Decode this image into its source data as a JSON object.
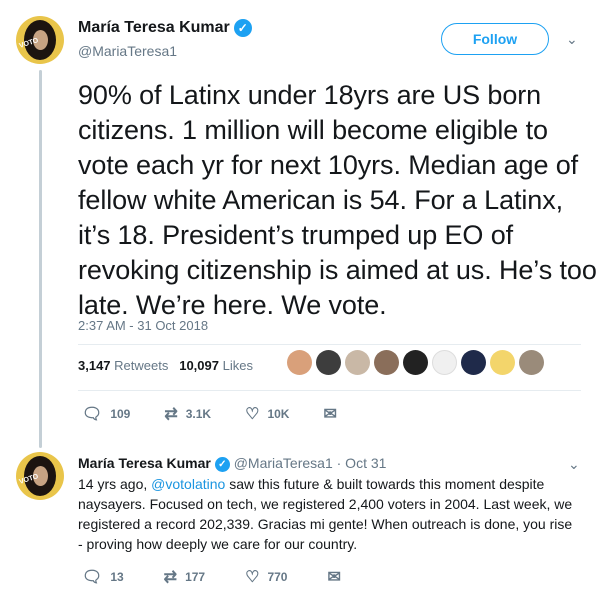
{
  "main_tweet": {
    "author_name": "María Teresa Kumar",
    "handle": "@MariaTeresa1",
    "follow_label": "Follow",
    "text": "90% of Latinx under 18yrs are US born citizens. 1 million will become eligible to vote each yr for next 10yrs. Median age of fellow white American is 54. For a Latinx, it’s 18. President’s trumped up EO of revoking citizenship is aimed at us. He’s too late. We’re here. We vote.",
    "timestamp": "2:37 AM - 31 Oct 2018",
    "retweets_count": "3,147",
    "retweets_label": "Retweets",
    "likes_count": "10,097",
    "likes_label": "Likes",
    "replies": "109",
    "retweets_short": "3.1K",
    "likes_short": "10K"
  },
  "reply_tweet": {
    "author_name": "María Teresa Kumar",
    "handle": "@MariaTeresa1",
    "date": "· Oct 31",
    "text_prefix": "14 yrs ago, ",
    "mention": "@votolatino",
    "text_rest": " saw this future & built towards this moment despite naysayers. Focused on tech, we registered 2,400 voters in 2004. Last week, we registered a record 202,339. Gracias mi gente! When outreach is done, you rise - proving how deeply we care for our country.",
    "replies": "13",
    "retweets": "177",
    "likes": "770"
  },
  "icons": {
    "verified": "verified-check",
    "reply": "reply-bubble",
    "retweet": "retweet-arrows",
    "like": "heart",
    "message": "envelope",
    "caret": "chevron-down"
  },
  "colors": {
    "accent": "#1da1f2",
    "text": "#14171a",
    "muted": "#657786",
    "avatar_bg": "#e9c54a"
  }
}
